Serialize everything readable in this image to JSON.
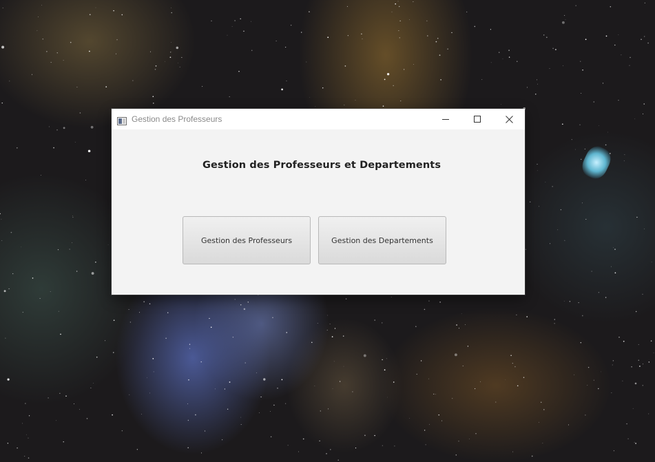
{
  "window": {
    "title": "Gestion des Professeurs",
    "controls": {
      "minimize": "minimize-icon",
      "maximize": "maximize-icon",
      "close": "close-icon"
    }
  },
  "main": {
    "heading": "Gestion des Professeurs et Departements",
    "buttons": {
      "professeurs_label": "Gestion des Professeurs",
      "departements_label": "Gestion des Departements"
    }
  },
  "colors": {
    "window_background": "#f3f3f3",
    "titlebar_background": "#ffffff",
    "title_text": "#8a8a8a",
    "heading_text": "#222222",
    "button_text": "#333333"
  }
}
